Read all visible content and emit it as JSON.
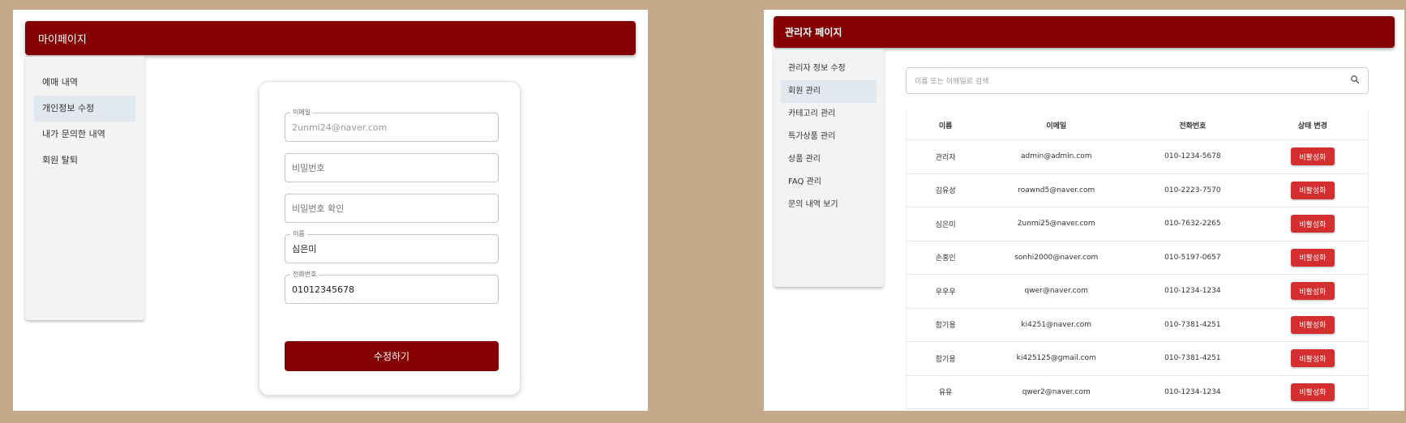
{
  "mypage": {
    "header_title": "마이페이지",
    "sidebar": {
      "items": [
        {
          "label": "예매 내역",
          "active": false
        },
        {
          "label": "개인정보 수정",
          "active": true
        },
        {
          "label": "내가 문의한 내역",
          "active": false
        },
        {
          "label": "회원 탈퇴",
          "active": false
        }
      ]
    },
    "form": {
      "email": {
        "label": "이메일",
        "value": "2unmi24@naver.com"
      },
      "password": {
        "placeholder": "비밀번호"
      },
      "password_confirm": {
        "placeholder": "비밀번호 확인"
      },
      "name": {
        "label": "이름",
        "value": "심은미"
      },
      "phone": {
        "label": "전화번호",
        "value": "01012345678"
      },
      "submit_label": "수정하기"
    }
  },
  "admin": {
    "header_title": "관리자 페이지",
    "sidebar": {
      "items": [
        {
          "label": "관리자 정보 수정",
          "active": false
        },
        {
          "label": "회원 관리",
          "active": true
        },
        {
          "label": "카테고리 관리",
          "active": false
        },
        {
          "label": "특가상품 관리",
          "active": false
        },
        {
          "label": "상품 관리",
          "active": false
        },
        {
          "label": "FAQ 관리",
          "active": false
        },
        {
          "label": "문의 내역 보기",
          "active": false
        }
      ]
    },
    "search": {
      "placeholder": "이름 또는 이메일로 검색",
      "icon": "search-icon"
    },
    "table": {
      "columns": [
        "이름",
        "이메일",
        "전화번호",
        "상태 변경"
      ],
      "rows": [
        {
          "name": "관리자",
          "email": "admin@admin.com",
          "phone": "010-1234-5678",
          "action": "비활성화"
        },
        {
          "name": "김유성",
          "email": "roawnd5@naver.com",
          "phone": "010-2223-7570",
          "action": "비활성화"
        },
        {
          "name": "심은미",
          "email": "2unmi25@naver.com",
          "phone": "010-7632-2265",
          "action": "비활성화"
        },
        {
          "name": "손홍인",
          "email": "sonhi2000@naver.com",
          "phone": "010-5197-0657",
          "action": "비활성화"
        },
        {
          "name": "우우우",
          "email": "qwer@naver.com",
          "phone": "010-1234-1234",
          "action": "비활성화"
        },
        {
          "name": "함기용",
          "email": "ki4251@naver.com",
          "phone": "010-7381-4251",
          "action": "비활성화"
        },
        {
          "name": "함기용",
          "email": "ki425125@gmail.com",
          "phone": "010-7381-4251",
          "action": "비활성화"
        },
        {
          "name": "유유",
          "email": "qwer2@naver.com",
          "phone": "010-1234-1234",
          "action": "비활성화"
        }
      ]
    }
  },
  "colors": {
    "brand": "#850000",
    "danger": "#d32f2f",
    "background": "#c4a98b",
    "sidebar_active": "#e1e8f0"
  }
}
